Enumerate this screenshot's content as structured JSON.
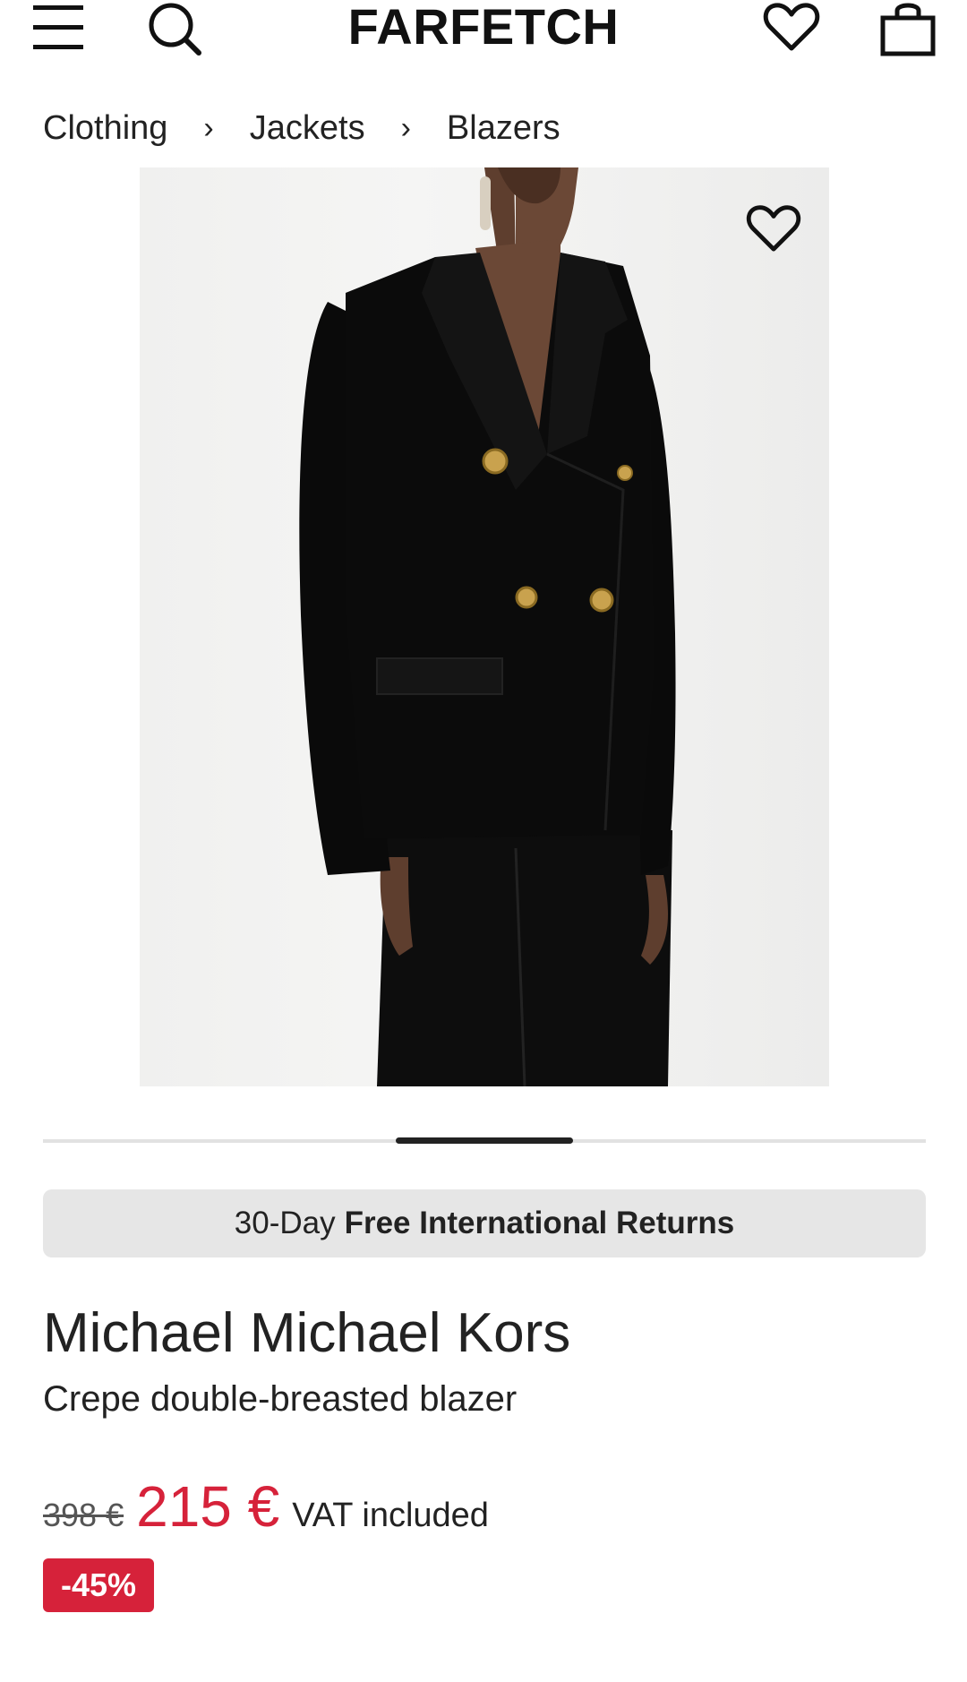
{
  "header": {
    "logo": "FARFETCH",
    "icons": {
      "menu": "hamburger-menu-icon",
      "search": "search-icon",
      "wishlist": "heart-icon",
      "bag": "shopping-bag-icon"
    }
  },
  "breadcrumb": {
    "items": [
      "Clothing",
      "Jackets",
      "Blazers"
    ],
    "separator": "›"
  },
  "gallery": {
    "image": "woman wearing black double-breasted blazer with gold buttons and black trousers",
    "wishlist_icon": "heart-icon",
    "position_fraction": 0.33
  },
  "returns_banner": {
    "prefix": "30-Day",
    "bold": "Free International Returns"
  },
  "product": {
    "brand": "Michael Michael Kors",
    "name": "Crepe double-breasted blazer"
  },
  "price": {
    "old": "398 €",
    "current": "215 €",
    "vat_note": "VAT included",
    "discount": "-45%",
    "accent_color": "#d6223a"
  }
}
